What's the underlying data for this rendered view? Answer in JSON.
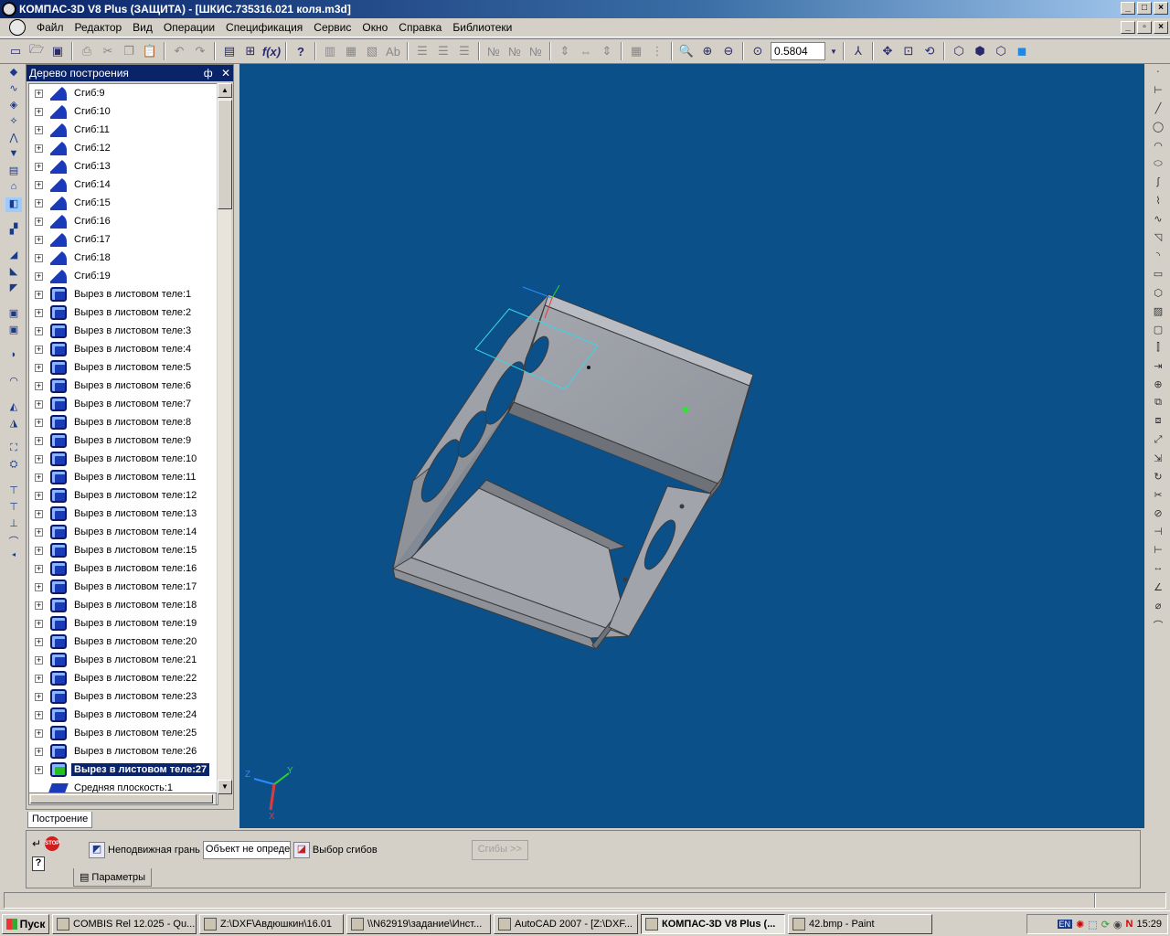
{
  "window": {
    "title": "КОМПАС-3D V8 Plus (ЗАЩИТА) - [ШКИС.735316.021 коля.m3d]"
  },
  "menu": [
    "Файл",
    "Редактор",
    "Вид",
    "Операции",
    "Спецификация",
    "Сервис",
    "Окно",
    "Справка",
    "Библиотеки"
  ],
  "toolbar": {
    "zoom_value": "0.5804"
  },
  "tree": {
    "title": "Дерево построения",
    "pin_glyph": "ф",
    "close_glyph": "✕",
    "tab_label": "Построение",
    "items": [
      "Сгиб:9",
      "Сгиб:10",
      "Сгиб:11",
      "Сгиб:12",
      "Сгиб:13",
      "Сгиб:14",
      "Сгиб:15",
      "Сгиб:16",
      "Сгиб:17",
      "Сгиб:18",
      "Сгиб:19",
      "Вырез в листовом теле:1",
      "Вырез в листовом теле:2",
      "Вырез в листовом теле:3",
      "Вырез в листовом теле:4",
      "Вырез в листовом теле:5",
      "Вырез в листовом теле:6",
      "Вырез в листовом теле:7",
      "Вырез в листовом теле:8",
      "Вырез в листовом теле:9",
      "Вырез в листовом теле:10",
      "Вырез в листовом теле:11",
      "Вырез в листовом теле:12",
      "Вырез в листовом теле:13",
      "Вырез в листовом теле:14",
      "Вырез в листовом теле:15",
      "Вырез в листовом теле:16",
      "Вырез в листовом теле:17",
      "Вырез в листовом теле:18",
      "Вырез в листовом теле:19",
      "Вырез в листовом теле:20",
      "Вырез в листовом теле:21",
      "Вырез в листовом теле:22",
      "Вырез в листовом теле:23",
      "Вырез в листовом теле:24",
      "Вырез в листовом теле:25",
      "Вырез в листовом теле:26"
    ],
    "selected_item": "Вырез в листовом теле:27",
    "last_item": "Средняя плоскость:1"
  },
  "viewport": {
    "background": "#0b5089",
    "axis_labels": {
      "x": "X",
      "y": "Y",
      "z": "Z"
    }
  },
  "params": {
    "fixed_face_label": "Неподвижная грань",
    "object_field_value": "Объект не определен",
    "select_bends_label": "Выбор сгибов",
    "bends_button": "Сгибы >>",
    "tab_label": "Параметры"
  },
  "taskbar": {
    "start": "Пуск",
    "tasks": [
      "COMBIS Rel 12.025 - Qu...",
      "Z:\\DXF\\Авдюшкин\\16.01",
      "\\\\N62919\\задание\\Инст...",
      "AutoCAD 2007 - [Z:\\DXF...",
      "КОМПАС-3D V8 Plus (...",
      "42.bmp - Paint"
    ],
    "active_task_index": 4,
    "lang": "EN",
    "clock": "15:29"
  },
  "colors": {
    "title_active": "#0a246a",
    "model_face": "#9a9ea6",
    "model_edge": "#3a3a3a",
    "sketch": "#38d6e6"
  }
}
